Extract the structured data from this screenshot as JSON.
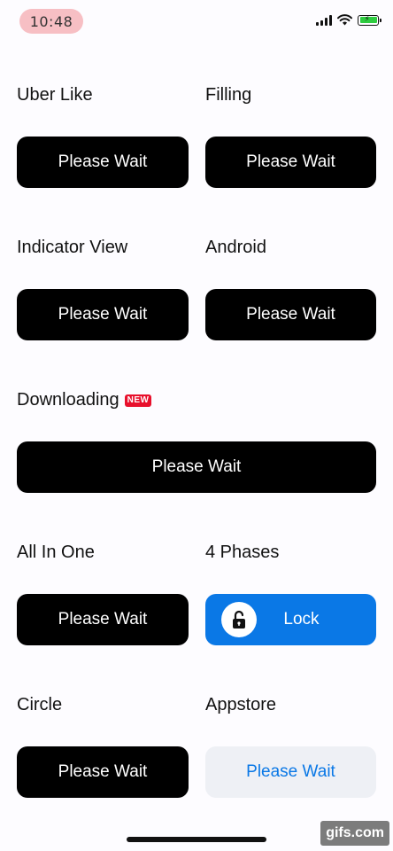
{
  "status_bar": {
    "time": "10:48"
  },
  "sections": {
    "uber_like": {
      "label": "Uber Like",
      "button": "Please Wait"
    },
    "filling": {
      "label": "Filling",
      "button": "Please Wait"
    },
    "indicator_view": {
      "label": "Indicator View",
      "button": "Please Wait"
    },
    "android": {
      "label": "Android",
      "button": "Please Wait"
    },
    "downloading": {
      "label": "Downloading",
      "badge": "NEW",
      "button": "Please Wait"
    },
    "all_in_one": {
      "label": "All In One",
      "button": "Please Wait"
    },
    "four_phases": {
      "label": "4 Phases",
      "button": "Lock",
      "icon": "open-lock-icon"
    },
    "circle": {
      "label": "Circle",
      "button": "Please Wait"
    },
    "appstore": {
      "label": "Appstore",
      "button": "Please Wait"
    }
  },
  "colors": {
    "primary_dark": "#000000",
    "accent_blue": "#0a78e6",
    "light_button": "#eef0f5",
    "badge_red": "#e8102c"
  },
  "watermark": "gifs.com"
}
